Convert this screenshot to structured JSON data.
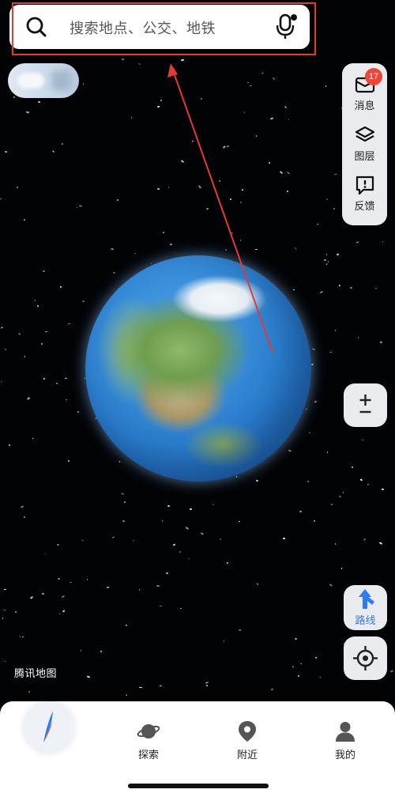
{
  "search": {
    "placeholder": "搜索地点、公交、地铁"
  },
  "side_panel": {
    "messages": {
      "label": "消息",
      "badge": "17"
    },
    "layers": {
      "label": "图层"
    },
    "feedback": {
      "label": "反馈"
    }
  },
  "zoom": {
    "label": "±"
  },
  "route": {
    "label": "路线"
  },
  "map_logo": "腾讯地图",
  "bottom_nav": {
    "items": [
      {
        "label": "探索",
        "icon": "planet-icon"
      },
      {
        "label": "附近",
        "icon": "location-pin-icon"
      },
      {
        "label": "我的",
        "icon": "user-icon"
      }
    ]
  },
  "colors": {
    "accent_blue": "#2f7bf5",
    "badge_red": "#f0443a",
    "annotation_red": "#e53935"
  }
}
